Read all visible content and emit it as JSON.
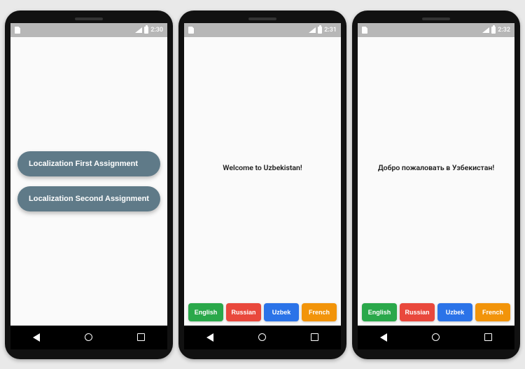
{
  "status": {
    "times": [
      "2:30",
      "2:31",
      "2:32"
    ]
  },
  "phone1": {
    "btn1": "Localization First Assignment",
    "btn2": "Localization Second Assignment"
  },
  "phone2": {
    "welcome": "Welcome to Uzbekistan!"
  },
  "phone3": {
    "welcome": "Добро пожаловать в Узбекистан!"
  },
  "lang": {
    "english": {
      "label": "English",
      "color": "#2aa84a"
    },
    "russian": {
      "label": "Russian",
      "color": "#e9483c"
    },
    "uzbek": {
      "label": "Uzbek",
      "color": "#2b73e8"
    },
    "french": {
      "label": "French",
      "color": "#f2940a"
    }
  }
}
